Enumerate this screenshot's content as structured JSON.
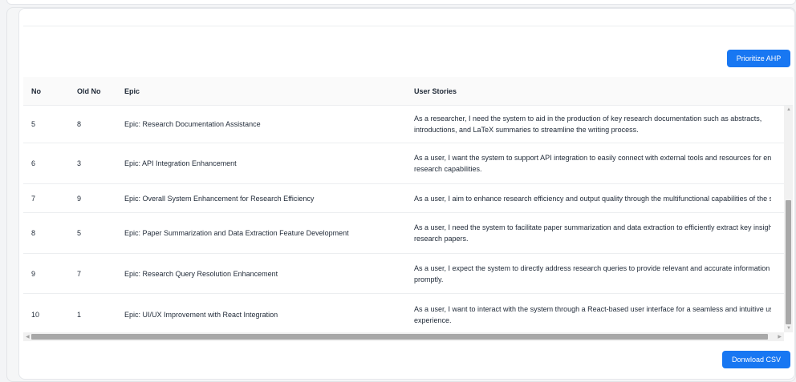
{
  "buttons": {
    "prioritize": "Prioritize AHP",
    "download": "Donwload CSV"
  },
  "table": {
    "headers": {
      "no": "No",
      "old_no": "Old No",
      "epic": "Epic",
      "user_stories": "User Stories"
    },
    "rows": [
      {
        "no": "5",
        "old_no": "8",
        "epic": "Epic: Research Documentation Assistance",
        "story_line1": "As a researcher, I need the system to aid in the production of key research documentation such as abstracts,",
        "story_line2": "introductions, and LaTeX summaries to streamline the writing process."
      },
      {
        "no": "6",
        "old_no": "3",
        "epic": "Epic: API Integration Enhancement",
        "story_line1": "As a user, I want the system to support API integration to easily connect with external tools and resources for enh",
        "story_line2": "research capabilities."
      },
      {
        "no": "7",
        "old_no": "9",
        "epic": "Epic: Overall System Enhancement for Research Efficiency",
        "story_line1": "As a user, I aim to enhance research efficiency and output quality through the multifunctional capabilities of the sy",
        "story_line2": ""
      },
      {
        "no": "8",
        "old_no": "5",
        "epic": "Epic: Paper Summarization and Data Extraction Feature Development",
        "story_line1": "As a user, I need the system to facilitate paper summarization and data extraction to efficiently extract key insight",
        "story_line2": "research papers."
      },
      {
        "no": "9",
        "old_no": "7",
        "epic": "Epic: Research Query Resolution Enhancement",
        "story_line1": "As a user, I expect the system to directly address research queries to provide relevant and accurate information",
        "story_line2": "promptly."
      },
      {
        "no": "10",
        "old_no": "1",
        "epic": "Epic: UI/UX Improvement with React Integration",
        "story_line1": "As a user, I want to interact with the system through a React-based user interface for a seamless and intuitive use",
        "story_line2": "experience."
      }
    ]
  },
  "colors": {
    "accent": "#1877f2",
    "header_bg": "#fafafa",
    "border": "#eceef0"
  },
  "icons": {
    "scroll_up": "caret-up-icon",
    "scroll_down": "caret-down-icon",
    "scroll_left": "caret-left-icon",
    "scroll_right": "caret-right-icon"
  }
}
